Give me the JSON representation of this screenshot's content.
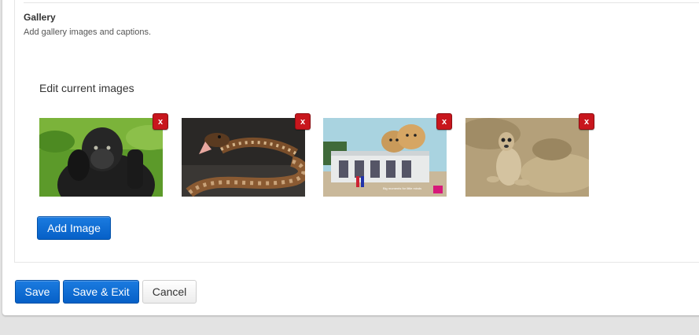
{
  "gallery": {
    "title": "Gallery",
    "description": "Add gallery images and captions.",
    "edit_heading": "Edit current images",
    "images": [
      {
        "subject": "gorilla",
        "remove_label": "x"
      },
      {
        "subject": "snake",
        "remove_label": "x"
      },
      {
        "subject": "lion cubs on building",
        "remove_label": "x",
        "banner_text": "Big moments for little minds"
      },
      {
        "subject": "meerkat",
        "remove_label": "x"
      }
    ],
    "add_image_label": "Add Image"
  },
  "actions": {
    "save_label": "Save",
    "save_exit_label": "Save & Exit",
    "cancel_label": "Cancel"
  },
  "colors": {
    "primary": "#0a66cc",
    "danger": "#c8161d"
  }
}
